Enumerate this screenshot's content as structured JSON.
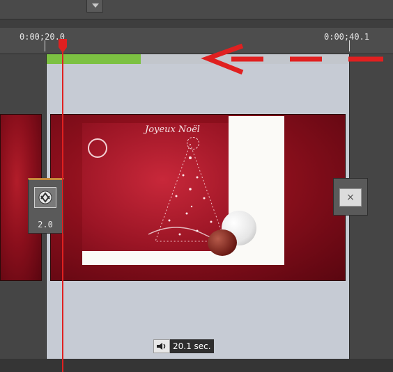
{
  "ruler": {
    "start_label": "0:00;20.0",
    "end_label": "0:00;40.1"
  },
  "clip": {
    "load_progress": 0.31,
    "card_title": "Joyeux Noël",
    "duration_label": "20.1 sec."
  },
  "transition": {
    "value": "2.0"
  },
  "close_button": {
    "label": "×"
  },
  "icons": [
    "chevron-down-icon",
    "transition-icon",
    "close-icon",
    "speaker-icon",
    "playhead-icon",
    "arrow-left-icon"
  ],
  "colors": {
    "playhead": "#e02020",
    "progress": "#7cc142",
    "clip_bg": "#c6cbd4",
    "annotation": "#e02020",
    "transition_accent": "#c68a3c"
  }
}
